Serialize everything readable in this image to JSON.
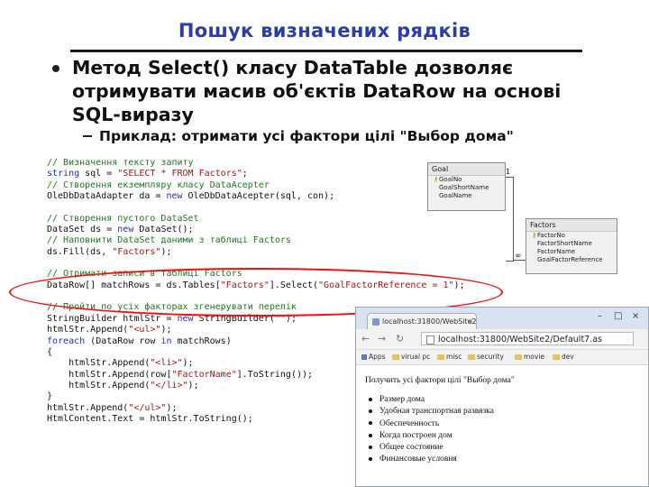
{
  "slide": {
    "title": "Пошук визначених рядків",
    "bullet": "Метод Select() класу DataTable дозволяє отримувати масив об'єктів DataRow на основі SQL-виразу",
    "sub_bullet": "Приклад: отримати усі фактори цілі \"Выбор дома\""
  },
  "code_lines": [
    [
      {
        "t": "// Визначення тексту запиту",
        "c": "cm"
      }
    ],
    [
      {
        "t": "string",
        "c": "kw"
      },
      {
        "t": " sql = ",
        "c": "tx"
      },
      {
        "t": "\"SELECT * FROM Factors\"",
        "c": "st"
      },
      {
        "t": ";",
        "c": "tx"
      }
    ],
    [
      {
        "t": "// Створення екземпляру класу DataAcepter",
        "c": "cm"
      }
    ],
    [
      {
        "t": "OleDbDataAdapter da = ",
        "c": "tx"
      },
      {
        "t": "new",
        "c": "kw"
      },
      {
        "t": " OleDbDataAcepter(sql, con);",
        "c": "tx"
      }
    ],
    [
      {
        "t": "",
        "c": "tx"
      }
    ],
    [
      {
        "t": "// Створення пустого DataSet",
        "c": "cm"
      }
    ],
    [
      {
        "t": "DataSet ds = ",
        "c": "tx"
      },
      {
        "t": "new",
        "c": "kw"
      },
      {
        "t": " DataSet();",
        "c": "tx"
      }
    ],
    [
      {
        "t": "// Наповнити DataSet даними з таблиці Factors",
        "c": "cm"
      }
    ],
    [
      {
        "t": "ds.Fill(ds, ",
        "c": "tx"
      },
      {
        "t": "\"Factors\"",
        "c": "st"
      },
      {
        "t": ");",
        "c": "tx"
      }
    ],
    [
      {
        "t": "",
        "c": "tx"
      }
    ],
    [
      {
        "t": "// Отримати записи в таблиці Factors",
        "c": "cm"
      }
    ],
    [
      {
        "t": "DataRow[] matchRows = ds.Tables[",
        "c": "tx"
      },
      {
        "t": "\"Factors\"",
        "c": "st"
      },
      {
        "t": "].Select(",
        "c": "tx"
      },
      {
        "t": "\"GoalFactorReference = 1\"",
        "c": "st"
      },
      {
        "t": ");",
        "c": "tx"
      }
    ],
    [
      {
        "t": "",
        "c": "tx"
      }
    ],
    [
      {
        "t": "// Пройти по усіх факторах згенерувати перелік",
        "c": "cm"
      }
    ],
    [
      {
        "t": "StringBuilder htmlStr = ",
        "c": "tx"
      },
      {
        "t": "new",
        "c": "kw"
      },
      {
        "t": " StringBuilder(",
        "c": "tx"
      },
      {
        "t": "\"\"",
        "c": "st"
      },
      {
        "t": ");",
        "c": "tx"
      }
    ],
    [
      {
        "t": "htmlStr.Append(",
        "c": "tx"
      },
      {
        "t": "\"<ul>\"",
        "c": "st"
      },
      {
        "t": ");",
        "c": "tx"
      }
    ],
    [
      {
        "t": "foreach",
        "c": "kw"
      },
      {
        "t": " (DataRow row ",
        "c": "tx"
      },
      {
        "t": "in",
        "c": "kw"
      },
      {
        "t": " matchRows)",
        "c": "tx"
      }
    ],
    [
      {
        "t": "{",
        "c": "tx"
      }
    ],
    [
      {
        "t": "    htmlStr.Append(",
        "c": "tx"
      },
      {
        "t": "\"<li>\"",
        "c": "st"
      },
      {
        "t": ");",
        "c": "tx"
      }
    ],
    [
      {
        "t": "    htmlStr.Append(row[",
        "c": "tx"
      },
      {
        "t": "\"FactorName\"",
        "c": "st"
      },
      {
        "t": "].ToString());",
        "c": "tx"
      }
    ],
    [
      {
        "t": "    htmlStr.Append(",
        "c": "tx"
      },
      {
        "t": "\"</li>\"",
        "c": "st"
      },
      {
        "t": ");",
        "c": "tx"
      }
    ],
    [
      {
        "t": "}",
        "c": "tx"
      }
    ],
    [
      {
        "t": "htmlStr.Append(",
        "c": "tx"
      },
      {
        "t": "\"</ul>\"",
        "c": "st"
      },
      {
        "t": ");",
        "c": "tx"
      }
    ],
    [
      {
        "t": "HtmlContent.Text = htmlStr.ToString();",
        "c": "tx"
      }
    ]
  ],
  "diagram": {
    "goal": {
      "name": "Goal",
      "fields": [
        "GoalNo",
        "GoalShortName",
        "GoalName"
      ]
    },
    "factors": {
      "name": "Factors",
      "fields": [
        "FactorNo",
        "FactorShortName",
        "FactorName",
        "GoalFactorReference"
      ]
    },
    "relation_one": "1",
    "relation_many": "∞"
  },
  "browser": {
    "tab_title": "localhost:31800/WebSite2/",
    "url": "localhost:31800/WebSite2/Default7.as",
    "bookmarks": [
      "Apps",
      "virual pc",
      "misc",
      "security",
      "movie",
      "dev"
    ],
    "page_heading": "Получить усі фактори цілі \"Выбор дома\"",
    "items": [
      "Размер дома",
      "Удобная транспортная развязка",
      "Обеспеченность",
      "Когда построен дом",
      "Общее состояние",
      "Финансовые условия"
    ],
    "window_controls": [
      "–",
      "□",
      "×"
    ]
  },
  "colors": {
    "title": "#2b3ea8",
    "comment": "#1a7a1a",
    "keyword": "#1b2fc2",
    "string": "#a31515",
    "highlight": "#e11111"
  }
}
